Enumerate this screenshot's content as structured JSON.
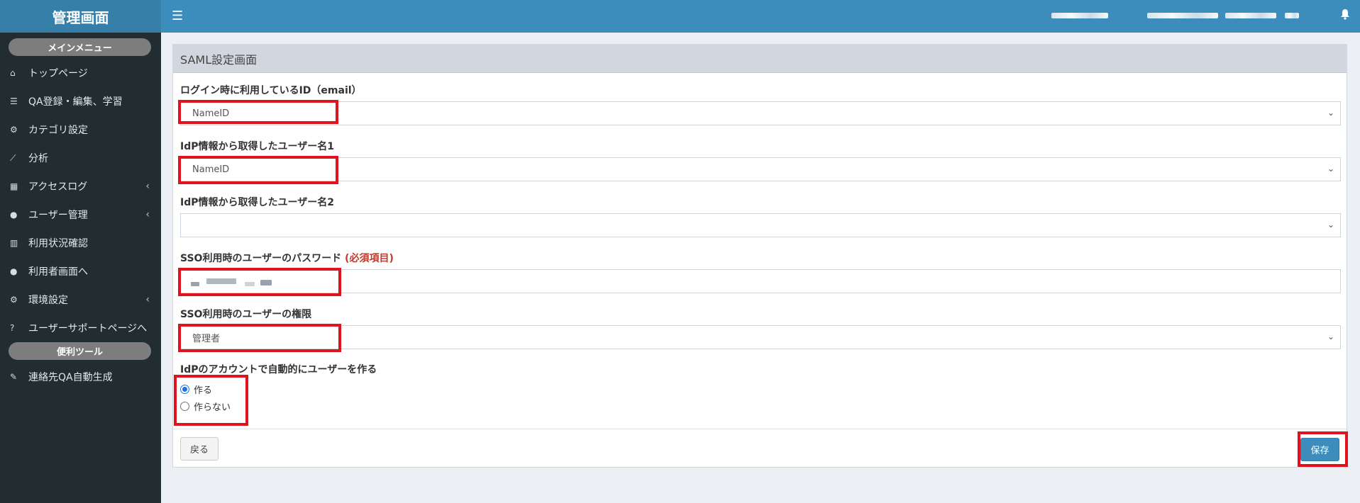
{
  "sidebar": {
    "brand": "管理画面",
    "main_menu_heading": "メインメニュー",
    "items": [
      {
        "icon": "home-icon",
        "glyph": "⌂",
        "label": "トップページ"
      },
      {
        "icon": "list-icon",
        "glyph": "☰",
        "label": "QA登録・編集、学習"
      },
      {
        "icon": "cogs-icon",
        "glyph": "⚙",
        "label": "カテゴリ設定"
      },
      {
        "icon": "chart-line-icon",
        "glyph": "⟋",
        "label": "分析"
      },
      {
        "icon": "grid-icon",
        "glyph": "▦",
        "label": "アクセスログ",
        "chevron": "‹"
      },
      {
        "icon": "user-icon",
        "glyph": "●",
        "label": "ユーザー管理",
        "chevron": "‹"
      },
      {
        "icon": "bar-chart-icon",
        "glyph": "▥",
        "label": "利用状況確認"
      },
      {
        "icon": "comments-icon",
        "glyph": "●",
        "label": "利用者画面へ"
      },
      {
        "icon": "gear-icon",
        "glyph": "⚙",
        "label": "環境設定",
        "chevron": "‹"
      },
      {
        "icon": "question-icon",
        "glyph": "?",
        "label": "ユーザーサポートページへ"
      }
    ],
    "tools_heading": "便利ツール",
    "tools": [
      {
        "icon": "magic-wand-icon",
        "glyph": "✎",
        "label": "連絡先QA自動生成"
      }
    ]
  },
  "topbar": {
    "menu_icon": "☰",
    "bell_icon": "bell-icon"
  },
  "page": {
    "title": "SAML設定画面",
    "fields": {
      "login_id": {
        "label": "ログイン時に利用しているID（email）",
        "value": "NameID"
      },
      "username1": {
        "label": "IdP情報から取得したユーザー名1",
        "value": "NameID"
      },
      "username2": {
        "label": "IdP情報から取得したユーザー名2",
        "value": ""
      },
      "password": {
        "label": "SSO利用時のユーザーのパスワード",
        "required": "(必須項目)"
      },
      "role": {
        "label": "SSO利用時のユーザーの権限",
        "value": "管理者"
      },
      "auto_create": {
        "label": "IdPのアカウントで自動的にユーザーを作る",
        "options": [
          "作る",
          "作らない"
        ],
        "selected": "作る"
      }
    },
    "back_label": "戻る",
    "save_label": "保存"
  },
  "colors": {
    "topbar": "#3c8dbc",
    "sidebar": "#222d32",
    "highlight": "#e1121f",
    "primary_button": "#3c8dbc",
    "required_text": "#c0392b"
  }
}
